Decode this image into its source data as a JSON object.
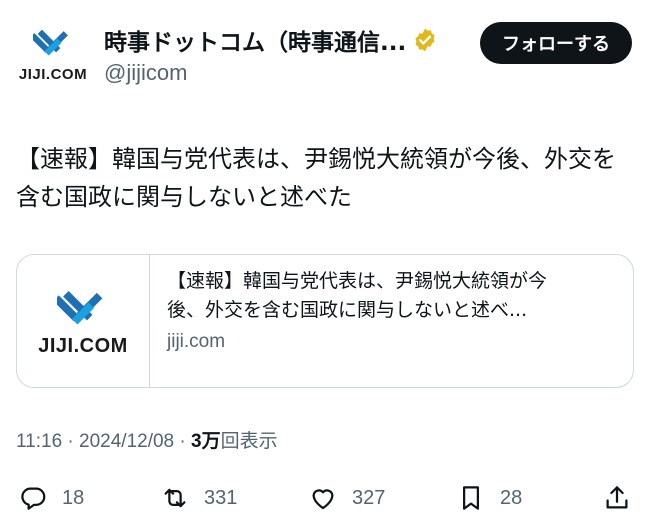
{
  "header": {
    "avatar_text": "JIJI.COM",
    "display_name": "時事ドットコム（時事通信...",
    "handle": "@jijicom",
    "follow_label": "フォローする"
  },
  "tweet": {
    "text": "【速報】韓国与党代表は、尹錫悦大統領が今後、外交を含む国政に関与しないと述べた"
  },
  "card": {
    "thumb_text": "JIJI.COM",
    "title_line1": "【速報】韓国与党代表は、尹錫悦大統領が今",
    "title_line2": "後、外交を含む国政に関与しないと述べ...",
    "domain": "jiji.com"
  },
  "meta": {
    "time": "11:16",
    "date": "2024/12/08",
    "separator": "·",
    "views_count": "3万",
    "views_label": "回表示"
  },
  "actions": {
    "replies": "18",
    "reposts": "331",
    "likes": "327",
    "bookmarks": "28"
  },
  "colors": {
    "accent": "#0f1419",
    "muted": "#536471",
    "verified_gold": "#e2b719",
    "jiji_blue": "#2a7fc4"
  }
}
